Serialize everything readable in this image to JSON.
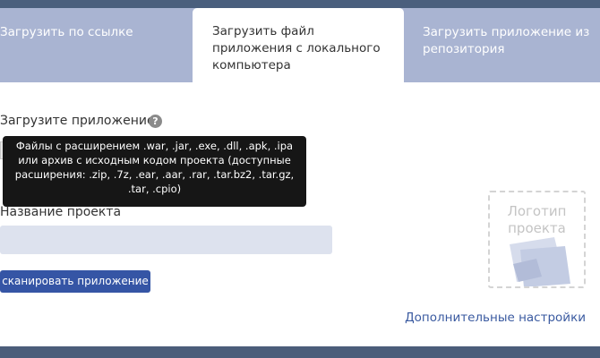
{
  "tabs": [
    {
      "label": "Загрузить по ссылке"
    },
    {
      "label": "Загрузить файл приложения с локального компьютера"
    },
    {
      "label": "Загрузить приложение из репозитория"
    }
  ],
  "form": {
    "upload_label": "Загрузите приложение",
    "help_icon_glyph": "?",
    "tooltip_text": "Файлы с расширением .war, .jar, .exe, .dll, .apk, .ipa или архив с исходным кодом проекта (доступные расширения: .zip, .7z, .ear, .aar, .rar, .tar.bz2, .tar.gz, .tar, .cpio)",
    "project_name_label": "Название проекта",
    "project_name_value": "",
    "scan_button_label": "сканировать приложение",
    "logo_placeholder": "Логотип проекта",
    "advanced_settings_link": "Дополнительные настройки"
  },
  "colors": {
    "tab_bar": "#a9b4d2",
    "primary_button": "#3555a5",
    "link": "#3a5aa0",
    "tooltip_bg": "#161616"
  }
}
